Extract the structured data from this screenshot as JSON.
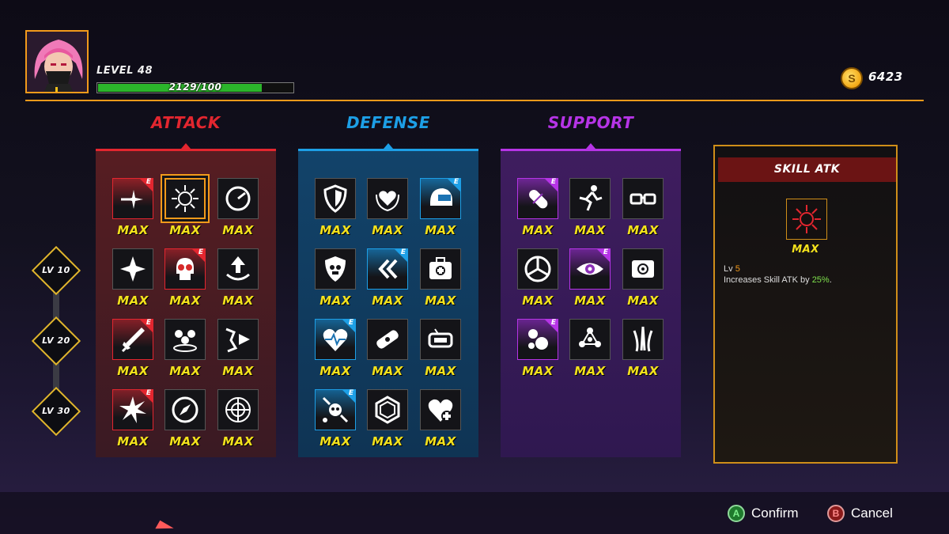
{
  "player": {
    "level_label": "LEVEL 48",
    "xp_text": "2129/100",
    "xp_fill_fraction": 0.84,
    "gold": "6423",
    "coin_glyph": "S"
  },
  "colors": {
    "accent": "#f29a1b",
    "attack": "#e3262f",
    "defense": "#1d9fe6",
    "support": "#b634e6",
    "max_text": "#f4e21c"
  },
  "columns": [
    {
      "title": "ATTACK",
      "skills": [
        {
          "icon": "burst-shot-icon",
          "label": "MAX",
          "equipped": true
        },
        {
          "icon": "spiked-orb-icon",
          "label": "MAX",
          "equipped": false,
          "selected": true
        },
        {
          "icon": "speed-gauge-icon",
          "label": "MAX",
          "equipped": false
        },
        {
          "icon": "star-burst-icon",
          "label": "MAX",
          "equipped": false
        },
        {
          "icon": "skull-icon",
          "label": "MAX",
          "equipped": true
        },
        {
          "icon": "arrow-trap-icon",
          "label": "MAX",
          "equipped": false
        },
        {
          "icon": "sword-icon",
          "label": "MAX",
          "equipped": true
        },
        {
          "icon": "trio-orbs-icon",
          "label": "MAX",
          "equipped": false
        },
        {
          "icon": "shatter-icon",
          "label": "MAX",
          "equipped": false
        },
        {
          "icon": "explosion-icon",
          "label": "MAX",
          "equipped": true
        },
        {
          "icon": "compass-icon",
          "label": "MAX",
          "equipped": false
        },
        {
          "icon": "crosshair-dial-icon",
          "label": "MAX",
          "equipped": false
        }
      ]
    },
    {
      "title": "DEFENSE",
      "skills": [
        {
          "icon": "shield-icon",
          "label": "MAX",
          "equipped": false
        },
        {
          "icon": "laurel-heart-icon",
          "label": "MAX",
          "equipped": false
        },
        {
          "icon": "helmet-icon",
          "label": "MAX",
          "equipped": true
        },
        {
          "icon": "skull-shield-icon",
          "label": "MAX",
          "equipped": false
        },
        {
          "icon": "double-chevron-icon",
          "label": "MAX",
          "equipped": true
        },
        {
          "icon": "medkit-icon",
          "label": "MAX",
          "equipped": false
        },
        {
          "icon": "heartbeat-icon",
          "label": "MAX",
          "equipped": true
        },
        {
          "icon": "bandage-icon",
          "label": "MAX",
          "equipped": false
        },
        {
          "icon": "battery-bot-icon",
          "label": "MAX",
          "equipped": false
        },
        {
          "icon": "repair-skull-icon",
          "label": "MAX",
          "equipped": true
        },
        {
          "icon": "hexagon-icon",
          "label": "MAX",
          "equipped": false
        },
        {
          "icon": "heart-plus-icon",
          "label": "MAX",
          "equipped": false
        }
      ]
    },
    {
      "title": "SUPPORT",
      "skills": [
        {
          "icon": "capsule-icon",
          "label": "MAX",
          "equipped": true
        },
        {
          "icon": "running-man-icon",
          "label": "MAX",
          "equipped": false
        },
        {
          "icon": "goggles-icon",
          "label": "MAX",
          "equipped": false
        },
        {
          "icon": "triskelion-icon",
          "label": "MAX",
          "equipped": false
        },
        {
          "icon": "eye-icon",
          "label": "MAX",
          "equipped": true
        },
        {
          "icon": "target-box-icon",
          "label": "MAX",
          "equipped": false
        },
        {
          "icon": "bubbles-icon",
          "label": "MAX",
          "equipped": true
        },
        {
          "icon": "molecule-icon",
          "label": "MAX",
          "equipped": false
        },
        {
          "icon": "claws-icon",
          "label": "MAX",
          "equipped": false
        }
      ]
    }
  ],
  "equipped_badge_letter": "E",
  "level_markers": [
    "LV 10",
    "LV 20",
    "LV 30"
  ],
  "detail": {
    "title": "SKILL ATK",
    "icon": "spiked-orb-icon",
    "max_label": "MAX",
    "lv_prefix": "Lv",
    "lv_value": "5",
    "desc_prefix": "Increases Skill ATK by",
    "desc_value": "25%",
    "desc_suffix": "."
  },
  "buttons": {
    "confirm_glyph": "A",
    "confirm_label": "Confirm",
    "cancel_glyph": "B",
    "cancel_label": "Cancel"
  }
}
